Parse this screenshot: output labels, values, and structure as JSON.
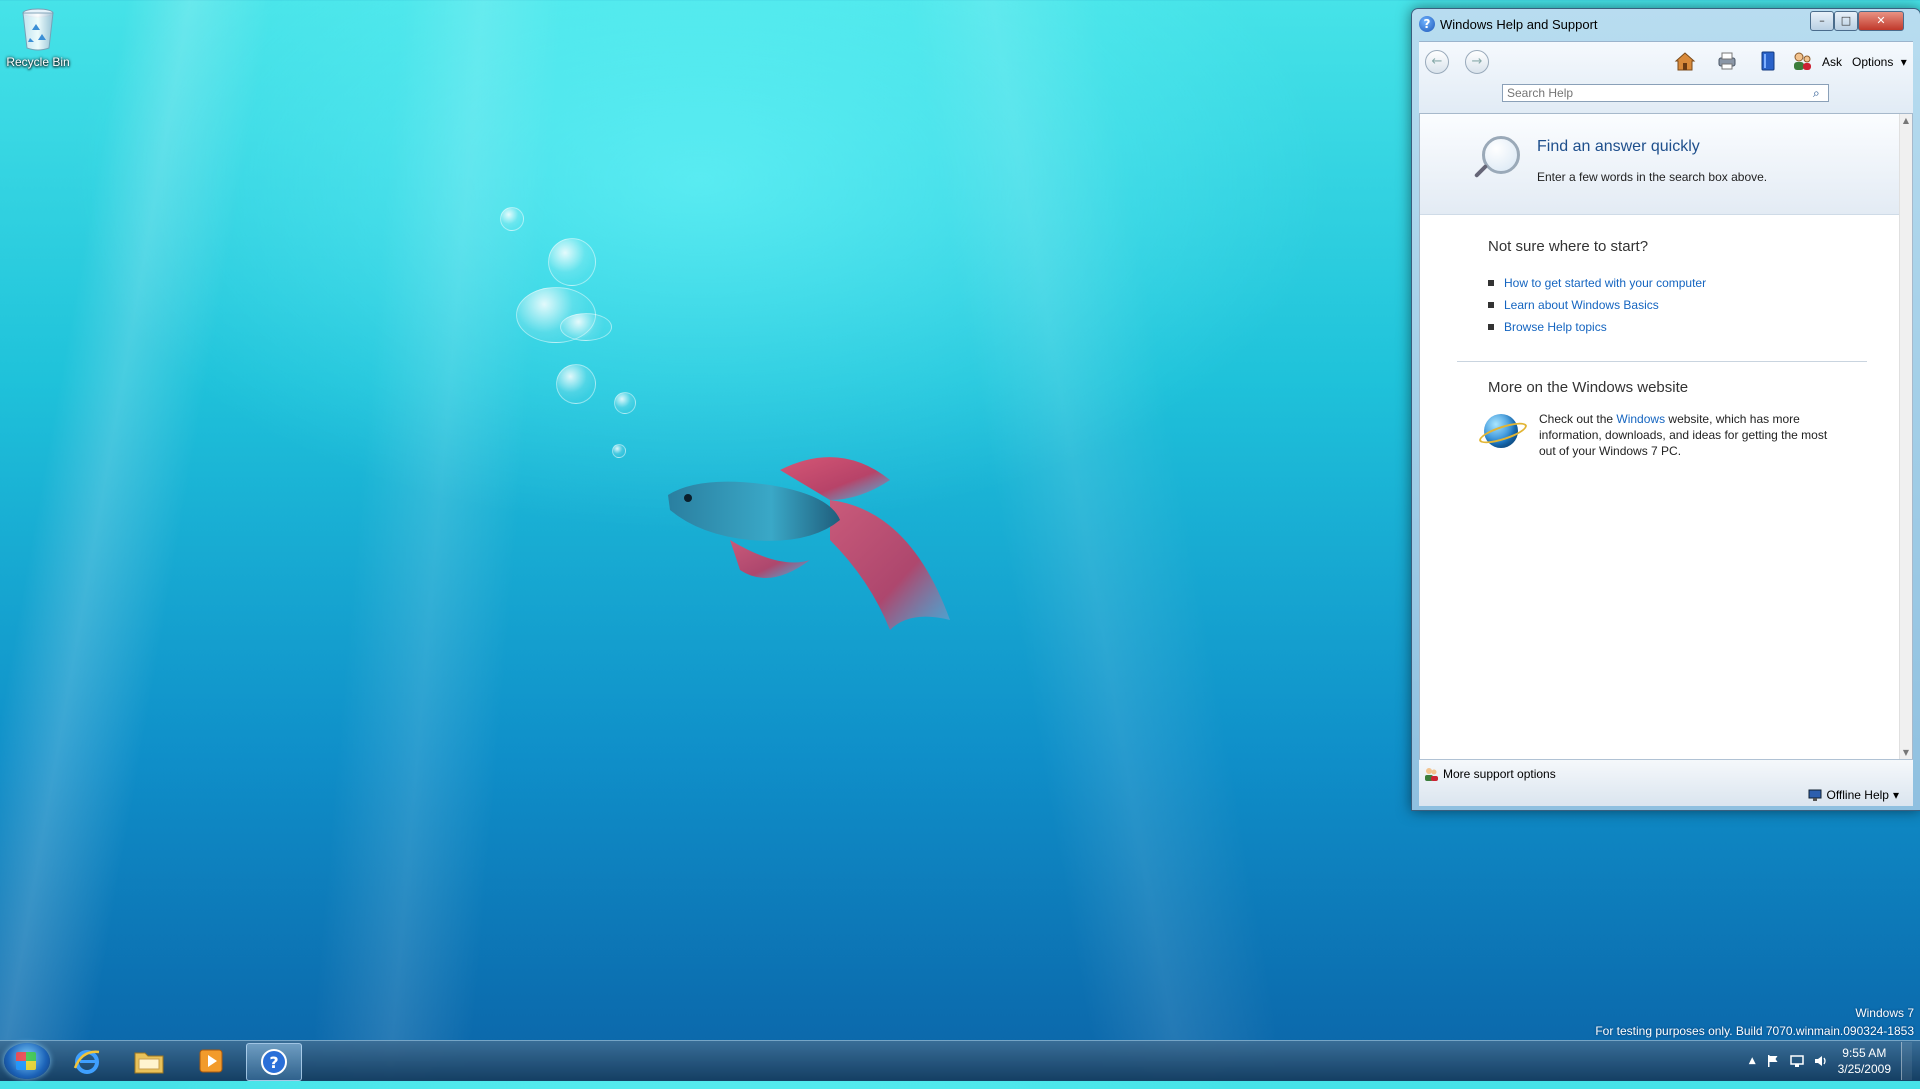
{
  "desktop": {
    "icons": [
      {
        "label": "Recycle Bin",
        "icon": "recycle-bin-icon"
      }
    ],
    "watermark": {
      "line1": "Windows 7",
      "line2": "For testing purposes only. Build 7070.winmain.090324-1853"
    }
  },
  "window": {
    "title": "Windows Help and Support",
    "controls": {
      "minimize": "–",
      "maximize": "□",
      "close": "✕"
    },
    "toolbar": {
      "back_glyph": "←",
      "forward_glyph": "→",
      "ask_label": "Ask",
      "options_label": "Options",
      "options_caret": "▾",
      "icons": [
        "home-icon",
        "print-icon",
        "browse-help-icon",
        "ask-person-icon"
      ]
    },
    "search": {
      "placeholder": "Search Help",
      "value": ""
    },
    "hero": {
      "title": "Find an answer quickly",
      "subtitle": "Enter a few words in the search box above."
    },
    "start_section": {
      "title": "Not sure where to start?",
      "links": [
        "How to get started with your computer",
        "Learn about Windows Basics",
        "Browse Help topics"
      ]
    },
    "website_section": {
      "title": "More on the Windows website",
      "text_before": "Check out the ",
      "link": "Windows",
      "text_after": " website, which has more information, downloads, and ideas for getting the most out of your Windows 7 PC."
    },
    "footer": {
      "more_support": "More support options",
      "offline_help": "Offline Help",
      "offline_caret": "▾"
    }
  },
  "taskbar": {
    "pinned": [
      "internet-explorer-icon",
      "windows-explorer-icon",
      "media-player-icon",
      "help-and-support-icon"
    ],
    "active": "help-and-support-icon",
    "help_glyph": "?",
    "tray_arrow": "▲",
    "tray_icons": [
      "action-center-flag-icon",
      "network-icon",
      "volume-icon"
    ],
    "clock": {
      "time": "9:55 AM",
      "date": "3/25/2009"
    }
  }
}
